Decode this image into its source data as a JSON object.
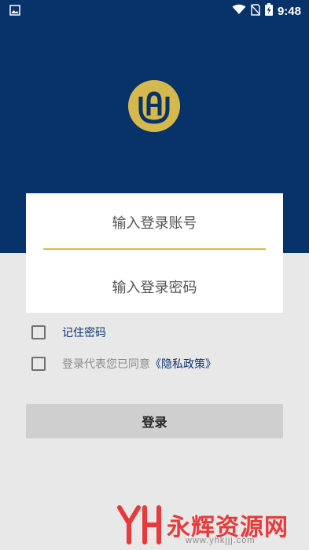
{
  "status_bar": {
    "time": "9:48",
    "icons": [
      "gallery-icon",
      "wifi-icon",
      "no-sim-icon",
      "battery-charging-icon"
    ]
  },
  "colors": {
    "header_bg": "#08336a",
    "accent_gold": "#d6b94c",
    "link_blue": "#0b3470",
    "page_bg": "#e8e8e8",
    "button_bg": "#cfcfcf"
  },
  "login_form": {
    "account_placeholder": "输入登录账号",
    "password_placeholder": "输入登录密码"
  },
  "options": {
    "remember_label": "记住密码",
    "agree_text": "登录代表您已同意",
    "policy_link": "《隐私政策》"
  },
  "actions": {
    "login_label": "登录"
  },
  "watermark": {
    "title": "永辉资源网",
    "url": "www.yhkjjj.com"
  }
}
